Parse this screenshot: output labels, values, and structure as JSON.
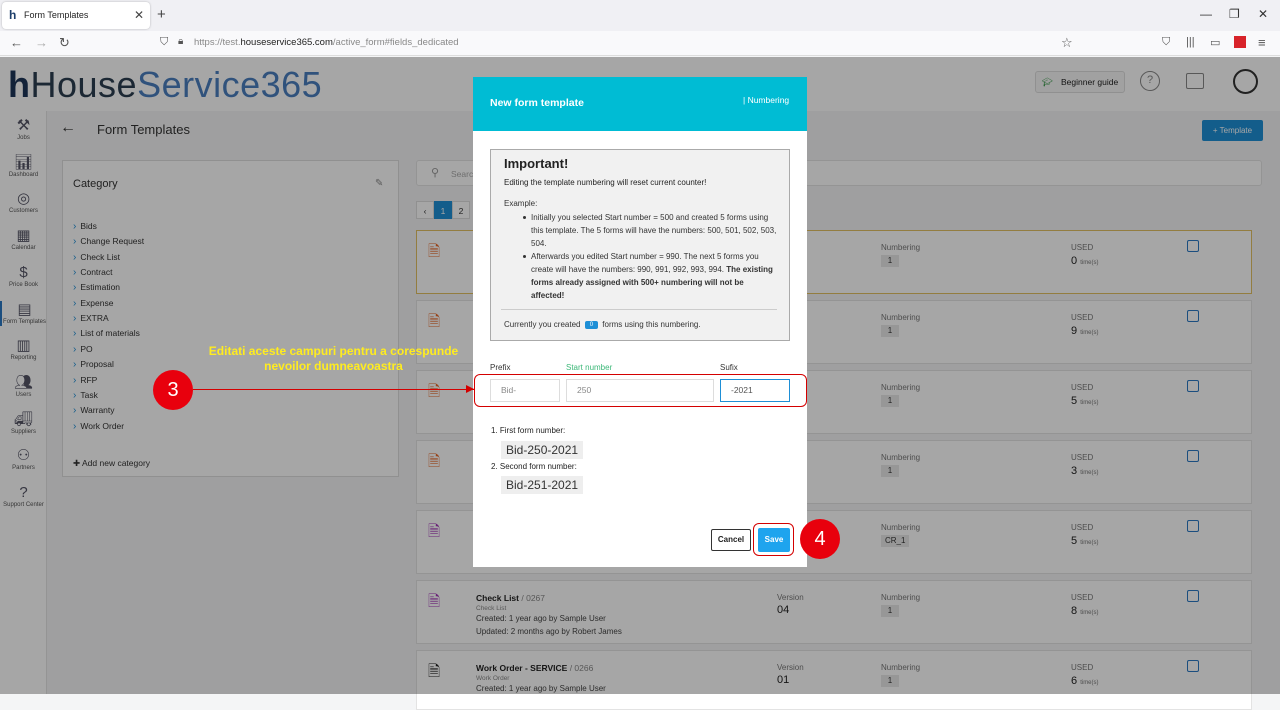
{
  "browser": {
    "tab_title": "Form Templates",
    "url_prefix": "https://test.",
    "url_host": "houseservice365.com",
    "url_path": "/active_form#fields_dedicated"
  },
  "app": {
    "logo_h": "h",
    "logo_house": "House",
    "logo_service": "Service365",
    "beginner_guide": "Beginner guide",
    "page_title": "Form Templates",
    "template_button": "+ Template",
    "search_placeholder": "Search"
  },
  "sidenav": [
    {
      "label": "Jobs",
      "icon": "tools-icon"
    },
    {
      "label": "Dashboard",
      "icon": "chart-icon"
    },
    {
      "label": "Customers",
      "icon": "target-icon"
    },
    {
      "label": "Calendar",
      "icon": "calendar-icon"
    },
    {
      "label": "Price Book",
      "icon": "price-icon"
    },
    {
      "label": "Form Templates",
      "icon": "form-icon"
    },
    {
      "label": "Reporting",
      "icon": "report-icon"
    },
    {
      "label": "Users",
      "icon": "users-icon"
    },
    {
      "label": "Suppliers",
      "icon": "truck-icon"
    },
    {
      "label": "Partners",
      "icon": "partners-icon"
    },
    {
      "label": "Support Center",
      "icon": "help-icon"
    }
  ],
  "category": {
    "title": "Category",
    "items": [
      "Bids",
      "Change Request",
      "Check List",
      "Contract",
      "Estimation",
      "Expense",
      "EXTRA",
      "List of materials",
      "PO",
      "Proposal",
      "RFP",
      "Task",
      "Warranty",
      "Work Order"
    ],
    "add_label": "Add new category"
  },
  "pagination": [
    "1",
    "2"
  ],
  "cards": [
    {
      "name": "",
      "code": "",
      "sub": "",
      "created": "",
      "updated": "",
      "version_label": "",
      "version": "",
      "numbering_label": "Numbering",
      "numbering": "1",
      "used_label": "USED",
      "used": "0",
      "used_unit": "time(s)",
      "color": "#e8692a"
    },
    {
      "name": "",
      "code": "",
      "sub": "",
      "created": "",
      "updated": "",
      "version_label": "",
      "version": "",
      "numbering_label": "Numbering",
      "numbering": "1",
      "used_label": "USED",
      "used": "9",
      "used_unit": "time(s)",
      "color": "#e8692a"
    },
    {
      "name": "",
      "code": "",
      "sub": "",
      "created": "",
      "updated": "",
      "version_label": "",
      "version": "",
      "numbering_label": "Numbering",
      "numbering": "1",
      "used_label": "USED",
      "used": "5",
      "used_unit": "time(s)",
      "color": "#e8692a"
    },
    {
      "name": "",
      "code": "",
      "sub": "",
      "created": "",
      "updated": "",
      "version_label": "",
      "version": "",
      "numbering_label": "Numbering",
      "numbering": "1",
      "used_label": "USED",
      "used": "3",
      "used_unit": "time(s)",
      "color": "#e8692a"
    },
    {
      "name": "",
      "code": "",
      "sub": "",
      "created": "",
      "updated": "",
      "version_label": "",
      "version": "",
      "numbering_label": "Numbering",
      "numbering": "CR_1",
      "used_label": "USED",
      "used": "5",
      "used_unit": "time(s)",
      "color": "#a335b8"
    },
    {
      "name": "Check List",
      "code": "/ 0267",
      "sub": "Check List",
      "created": "Created: 1 year ago by Sample User",
      "updated": "Updated: 2 months ago by Robert James",
      "version_label": "Version",
      "version": "04",
      "numbering_label": "Numbering",
      "numbering": "1",
      "used_label": "USED",
      "used": "8",
      "used_unit": "time(s)",
      "color": "#a335b8"
    },
    {
      "name": "Work Order - SERVICE",
      "code": "/ 0266",
      "sub": "Work Order",
      "created": "Created: 1 year ago by Sample User",
      "updated": "",
      "version_label": "Version",
      "version": "01",
      "numbering_label": "Numbering",
      "numbering": "1",
      "used_label": "USED",
      "used": "6",
      "used_unit": "time(s)",
      "color": "#222222"
    }
  ],
  "modal": {
    "title": "New form template",
    "tab": "| Numbering",
    "important_title": "Important!",
    "important_warning": "Editing the template numbering will reset current counter!",
    "example_label": "Example:",
    "example_1": "Initially you selected Start number = 500 and created 5 forms using this template. The 5 forms will have the numbers: 500, 501, 502, 503, 504.",
    "example_2a": "Afterwards you edited Start number = 990. The next 5 forms you create will have the numbers: 990, 991, 992, 993, 994. ",
    "example_2b": "The existing forms already assigned with 500+ numbering will not be affected!",
    "count_prefix": "Currently you created",
    "count_value": "0",
    "count_suffix": "forms using this numbering.",
    "prefix_label": "Prefix",
    "start_label": "Start number",
    "suffix_label": "Sufix",
    "prefix_value": "Bid-",
    "start_value": "250",
    "suffix_value": "-2021",
    "first_label": "1. First form number:",
    "first_value": "Bid-250-2021",
    "second_label": "2. Second form number:",
    "second_value": "Bid-251-2021",
    "cancel": "Cancel",
    "save": "Save"
  },
  "annotations": {
    "step3": "3",
    "step4": "4",
    "text": "Editati aceste campuri pentru a corespunde nevoilor dumneavoastra"
  },
  "colors": {
    "accent": "#1e8fd6",
    "modal_header": "#00bcd4",
    "annotation_red": "#e8000d",
    "annotation_text": "#ffec1f"
  }
}
